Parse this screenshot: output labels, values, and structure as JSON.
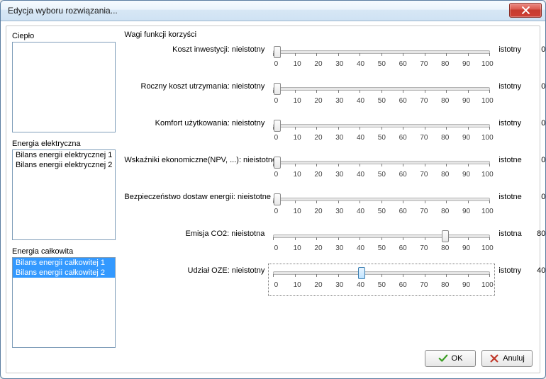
{
  "window": {
    "title": "Edycja wyboru rozwiązania..."
  },
  "left": {
    "heat_label": "Ciepło",
    "heat_items": [],
    "elec_label": "Energia elektryczna",
    "elec_items": [
      {
        "label": "Bilans energii elektrycznej 1",
        "selected": false
      },
      {
        "label": "Bilans energii elektrycznej 2",
        "selected": false
      }
    ],
    "total_label": "Energia całkowita",
    "total_items": [
      {
        "label": "Bilans energii całkowitej 1",
        "selected": true
      },
      {
        "label": "Bilans energii całkowitej 2",
        "selected": true
      }
    ]
  },
  "right": {
    "group_title": "Wagi funkcji korzyści",
    "ticks": [
      "0",
      "10",
      "20",
      "30",
      "40",
      "50",
      "60",
      "70",
      "80",
      "90",
      "100"
    ],
    "sliders": [
      {
        "label": "Koszt inwestycji:",
        "left_word": "nieistotny",
        "right_word": "istotny",
        "value": 0,
        "focused": false
      },
      {
        "label": "Roczny koszt utrzymania:",
        "left_word": "nieistotny",
        "right_word": "istotny",
        "value": 0,
        "focused": false
      },
      {
        "label": "Komfort użytkowania:",
        "left_word": "nieistotny",
        "right_word": "istotny",
        "value": 0,
        "focused": false
      },
      {
        "label": "Wskaźniki ekonomiczne(NPV, ...):",
        "left_word": "nieistotne",
        "right_word": "istotne",
        "value": 0,
        "focused": false
      },
      {
        "label": "Bezpieczeństwo dostaw energii:",
        "left_word": "nieistotne",
        "right_word": "istotne",
        "value": 0,
        "focused": false
      },
      {
        "label": "Emisja CO2:",
        "left_word": "nieistotna",
        "right_word": "istotna",
        "value": 80,
        "focused": false
      },
      {
        "label": "Udział OZE:",
        "left_word": "nieistotny",
        "right_word": "istotny",
        "value": 40,
        "focused": true
      }
    ]
  },
  "buttons": {
    "ok": "OK",
    "cancel": "Anuluj"
  }
}
